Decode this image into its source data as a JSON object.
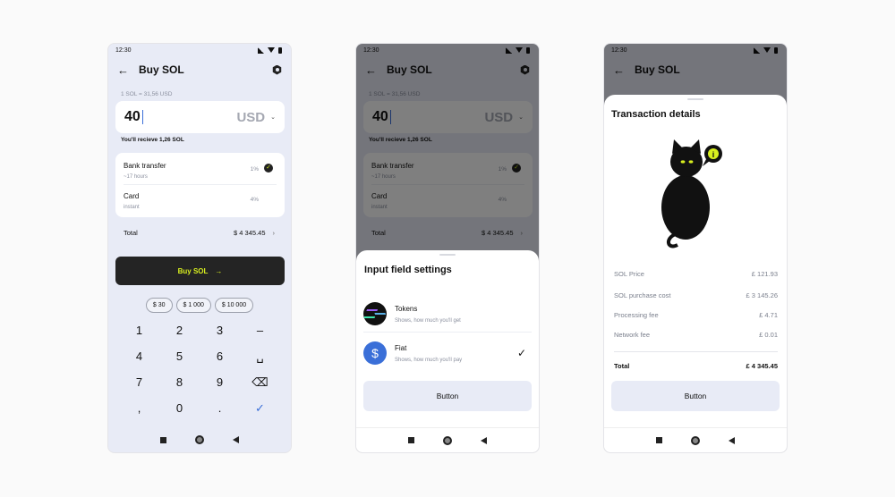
{
  "status_time": "12:30",
  "screen1": {
    "title": "Buy SOL",
    "rate": "1 SOL = 31,56 USD",
    "amount": "40",
    "currency": "USD",
    "receive": "You'll recieve 1,26 SOL",
    "methods": [
      {
        "name": "Bank transfer",
        "sub": "~17 hours",
        "fee": "1%",
        "selected": true
      },
      {
        "name": "Card",
        "sub": "instant",
        "fee": "4%",
        "selected": false
      }
    ],
    "total_label": "Total",
    "total_value": "$ 4 345.45",
    "buy_label": "Buy SOL",
    "chips": [
      "$ 30",
      "$ 1 000",
      "$ 10 000"
    ],
    "keys": [
      "1",
      "2",
      "3",
      "–",
      "4",
      "5",
      "6",
      "␣",
      "7",
      "8",
      "9",
      "⌫",
      ",",
      "0",
      ".",
      "✓"
    ]
  },
  "screen2": {
    "sheet_title": "Input field settings",
    "options": [
      {
        "name": "Tokens",
        "sub": "Shows, how much you'll get"
      },
      {
        "name": "Fiat",
        "sub": "Shows, how much you'll pay",
        "icon_symbol": "$"
      }
    ],
    "button": "Button"
  },
  "screen3": {
    "sheet_title": "Transaction details",
    "rows": [
      {
        "label": "SOL Price",
        "value": "£ 121.93"
      },
      {
        "label": "SOL purchase cost",
        "value": "£ 3 145.26"
      },
      {
        "label": "Processing fee",
        "value": "£ 4.71"
      },
      {
        "label": "Network fee",
        "value": "£ 0.01"
      }
    ],
    "total_label": "Total",
    "total_value": "£ 4 345.45",
    "button": "Button",
    "bubble_symbol": "i"
  },
  "colors": {
    "accent": "#d8ef1f",
    "button_dark": "#242424",
    "blue": "#3a6fd8",
    "surface": "#e8ebf6"
  }
}
